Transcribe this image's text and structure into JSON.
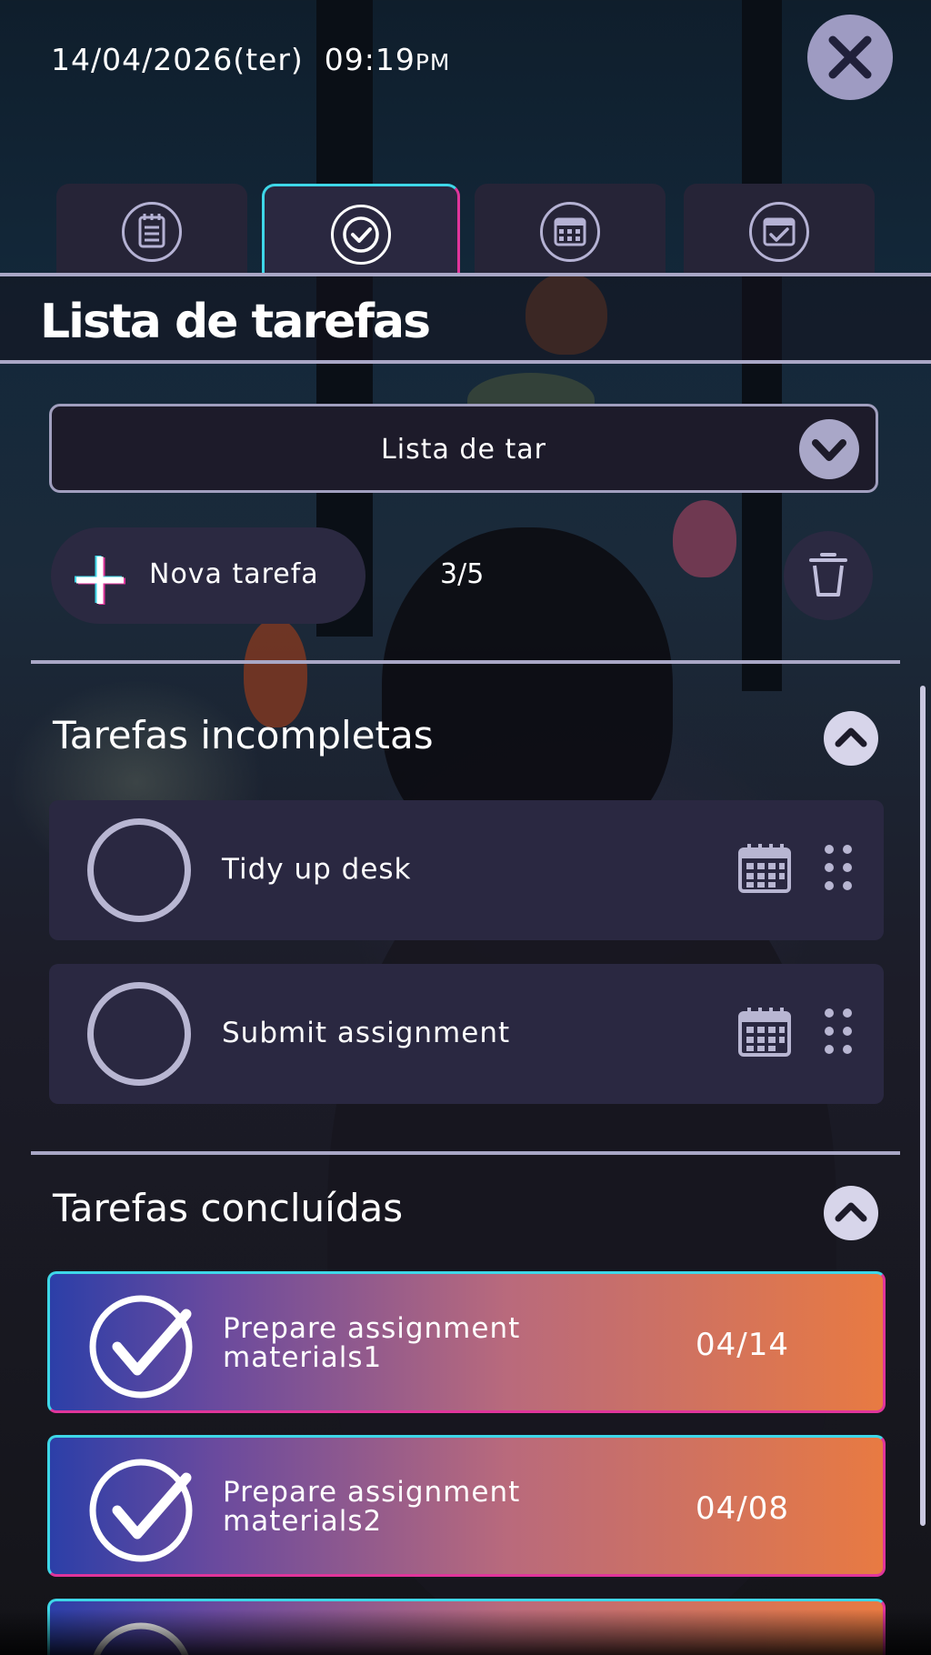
{
  "status": {
    "date": "14/04/2026(ter)",
    "time": "09:19",
    "ampm": "PM"
  },
  "tabs": [
    {
      "icon": "notepad-icon",
      "active": false
    },
    {
      "icon": "checkmark-circle-icon",
      "active": true
    },
    {
      "icon": "calendar-icon",
      "active": false
    },
    {
      "icon": "calendar-check-icon",
      "active": false
    }
  ],
  "page": {
    "title": "Lista de tarefas"
  },
  "list_select": {
    "value": "Lista de tar"
  },
  "actions": {
    "new_task_label": "Nova tarefa",
    "count": "3/5"
  },
  "incomplete": {
    "title": "Tarefas incompletas",
    "items": [
      {
        "label": "Tidy up desk"
      },
      {
        "label": "Submit assignment"
      }
    ]
  },
  "completed": {
    "title": "Tarefas concluídas",
    "items": [
      {
        "line1": "Prepare assignment",
        "line2": "materials1",
        "date": "04/14"
      },
      {
        "line1": "Prepare assignment",
        "line2": "materials2",
        "date": "04/08"
      }
    ]
  },
  "colors": {
    "accent_cyan": "#3ed7e8",
    "accent_magenta": "#e0359b",
    "row_bg": "#2a2841",
    "gradient_start": "#2c3fa8",
    "gradient_end": "#e87a42"
  }
}
